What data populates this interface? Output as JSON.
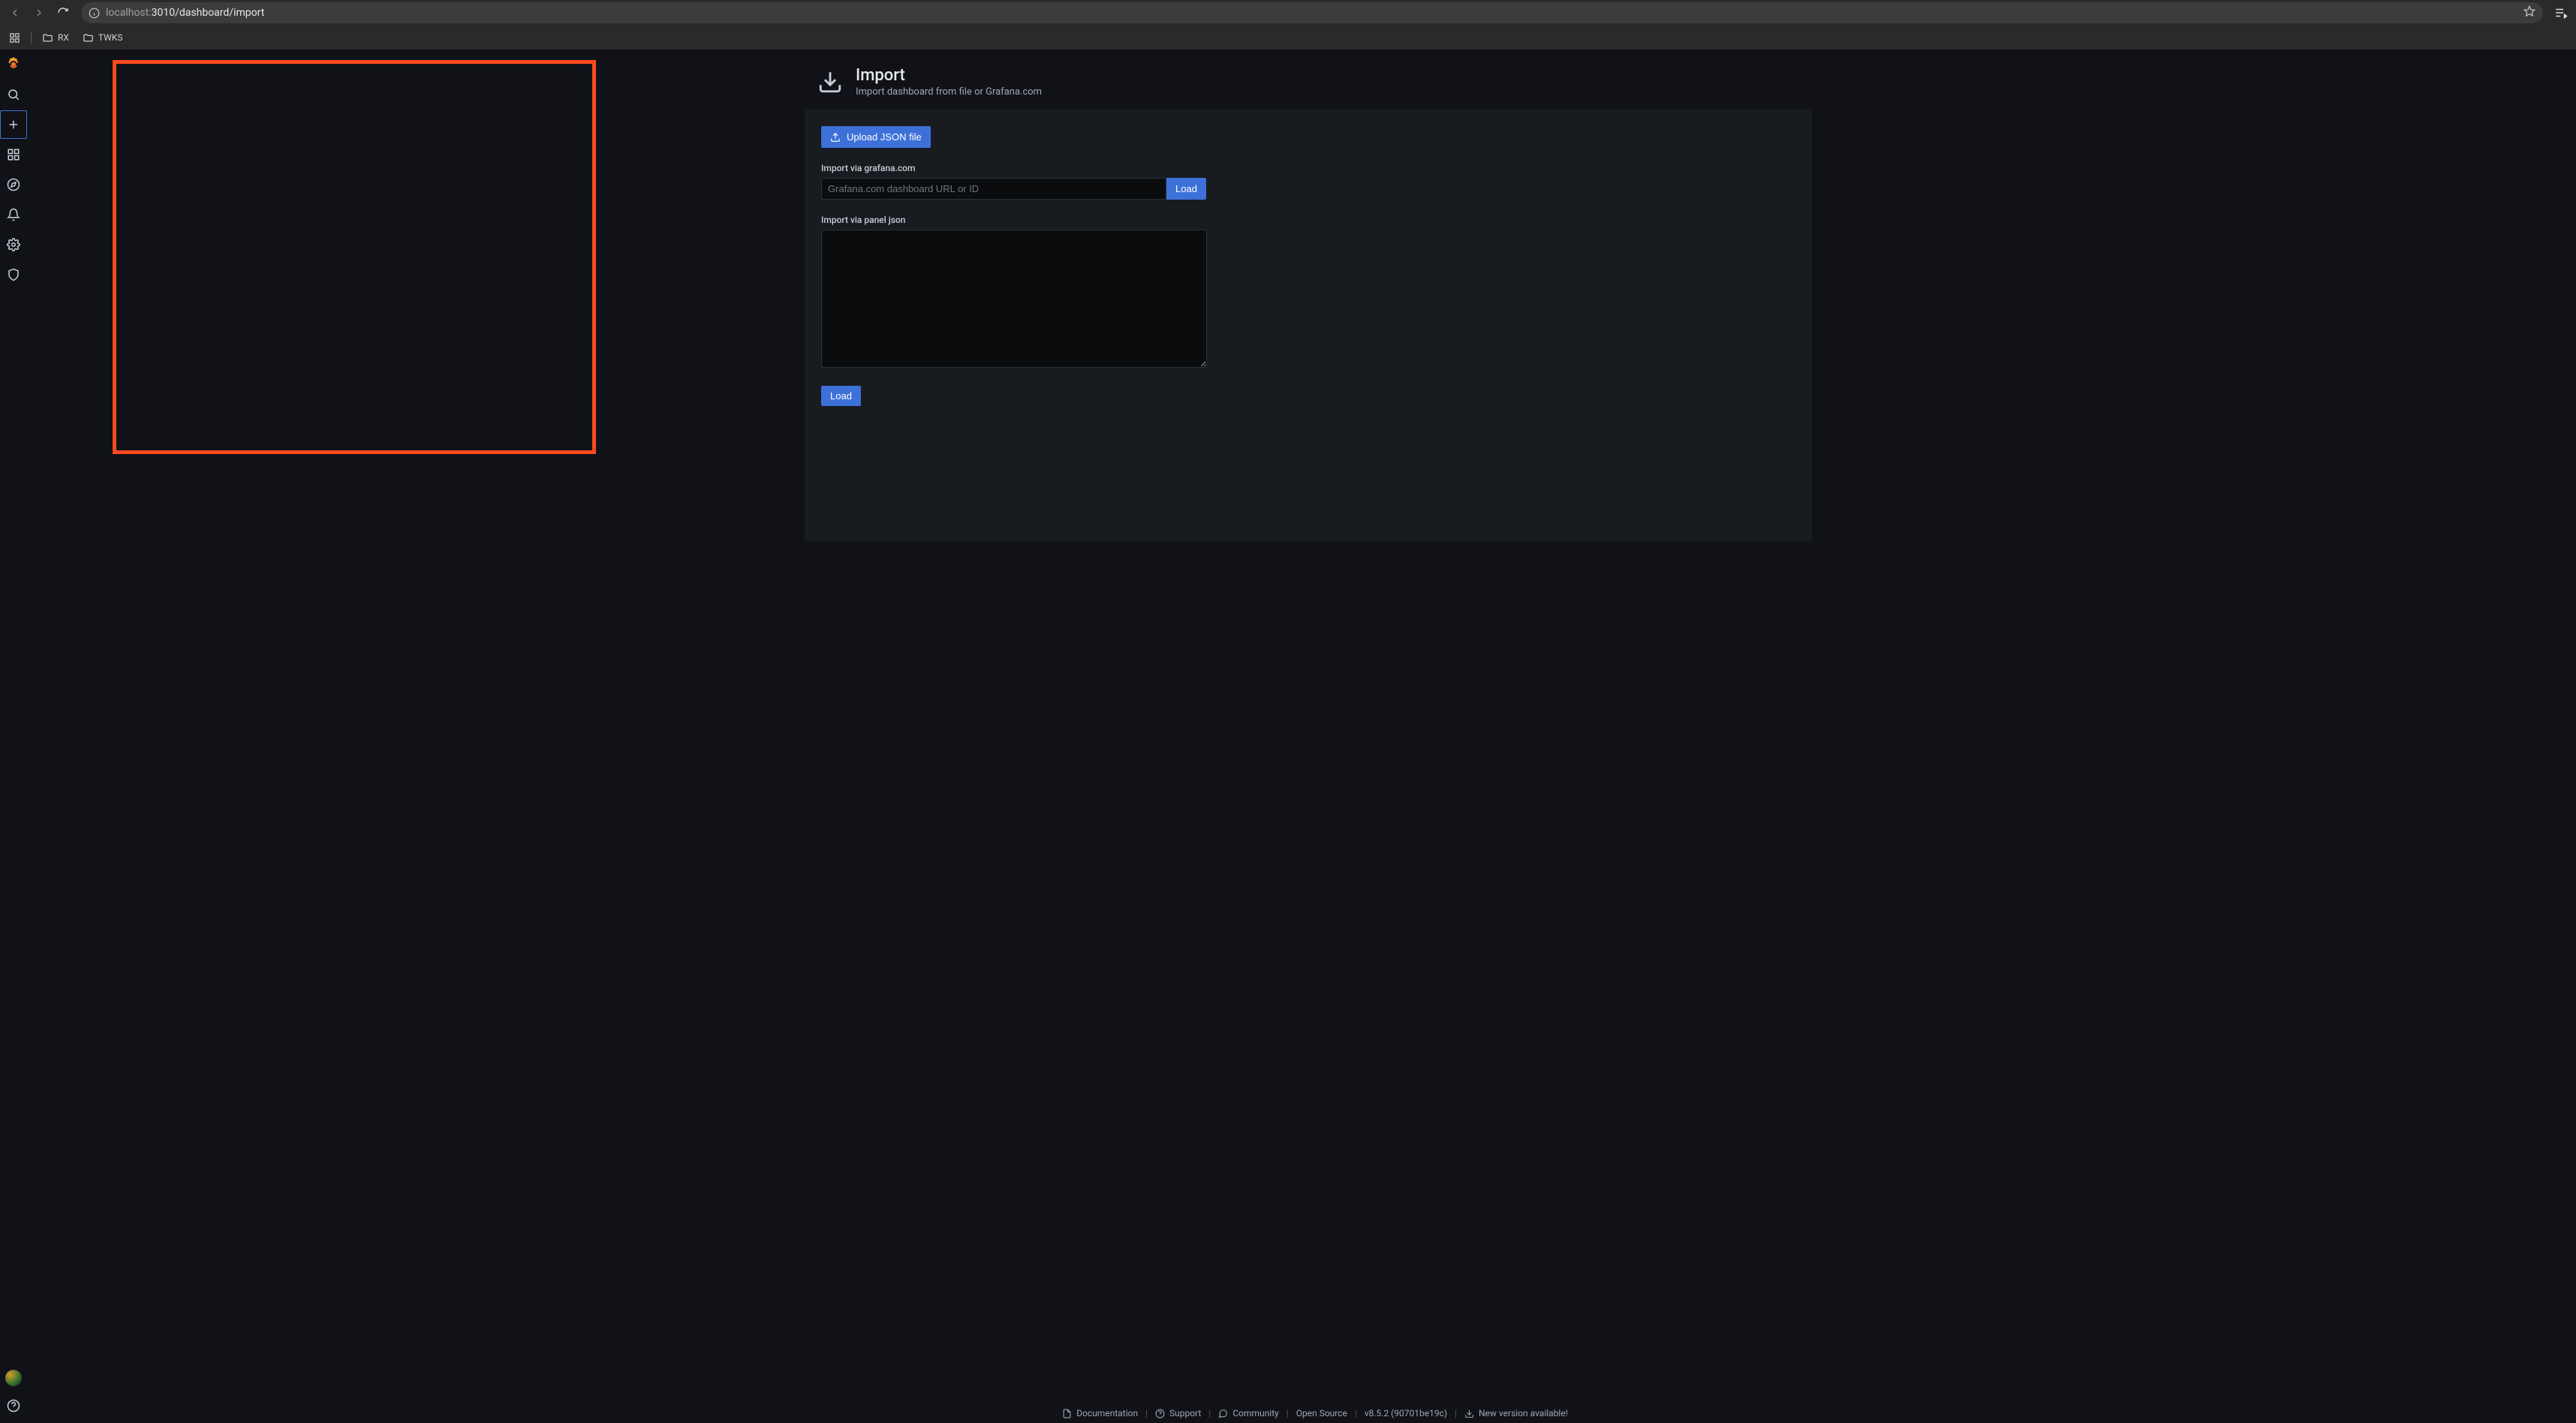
{
  "browser": {
    "url_host": "localhost:",
    "url_rest": "3010/dashboard/import",
    "bookmarks": [
      {
        "label": "RX"
      },
      {
        "label": "TWKS"
      }
    ]
  },
  "sidebar": {
    "items": [
      {
        "name": "logo"
      },
      {
        "name": "search"
      },
      {
        "name": "create"
      },
      {
        "name": "dashboards"
      },
      {
        "name": "explore"
      },
      {
        "name": "alerting"
      },
      {
        "name": "configuration"
      },
      {
        "name": "admin-shield"
      }
    ]
  },
  "page": {
    "title": "Import",
    "subtitle": "Import dashboard from file or Grafana.com"
  },
  "panel": {
    "upload_btn": "Upload JSON file",
    "grafana_com_label": "Import via grafana.com",
    "grafana_com_placeholder": "Grafana.com dashboard URL or ID",
    "load_btn": "Load",
    "panel_json_label": "Import via panel json",
    "panel_json_value": "",
    "load_btn2": "Load"
  },
  "footer": {
    "documentation": "Documentation",
    "support": "Support",
    "community": "Community",
    "open_source": "Open Source",
    "version": "v8.5.2 (90701be19c)",
    "new_version": "New version available!"
  }
}
